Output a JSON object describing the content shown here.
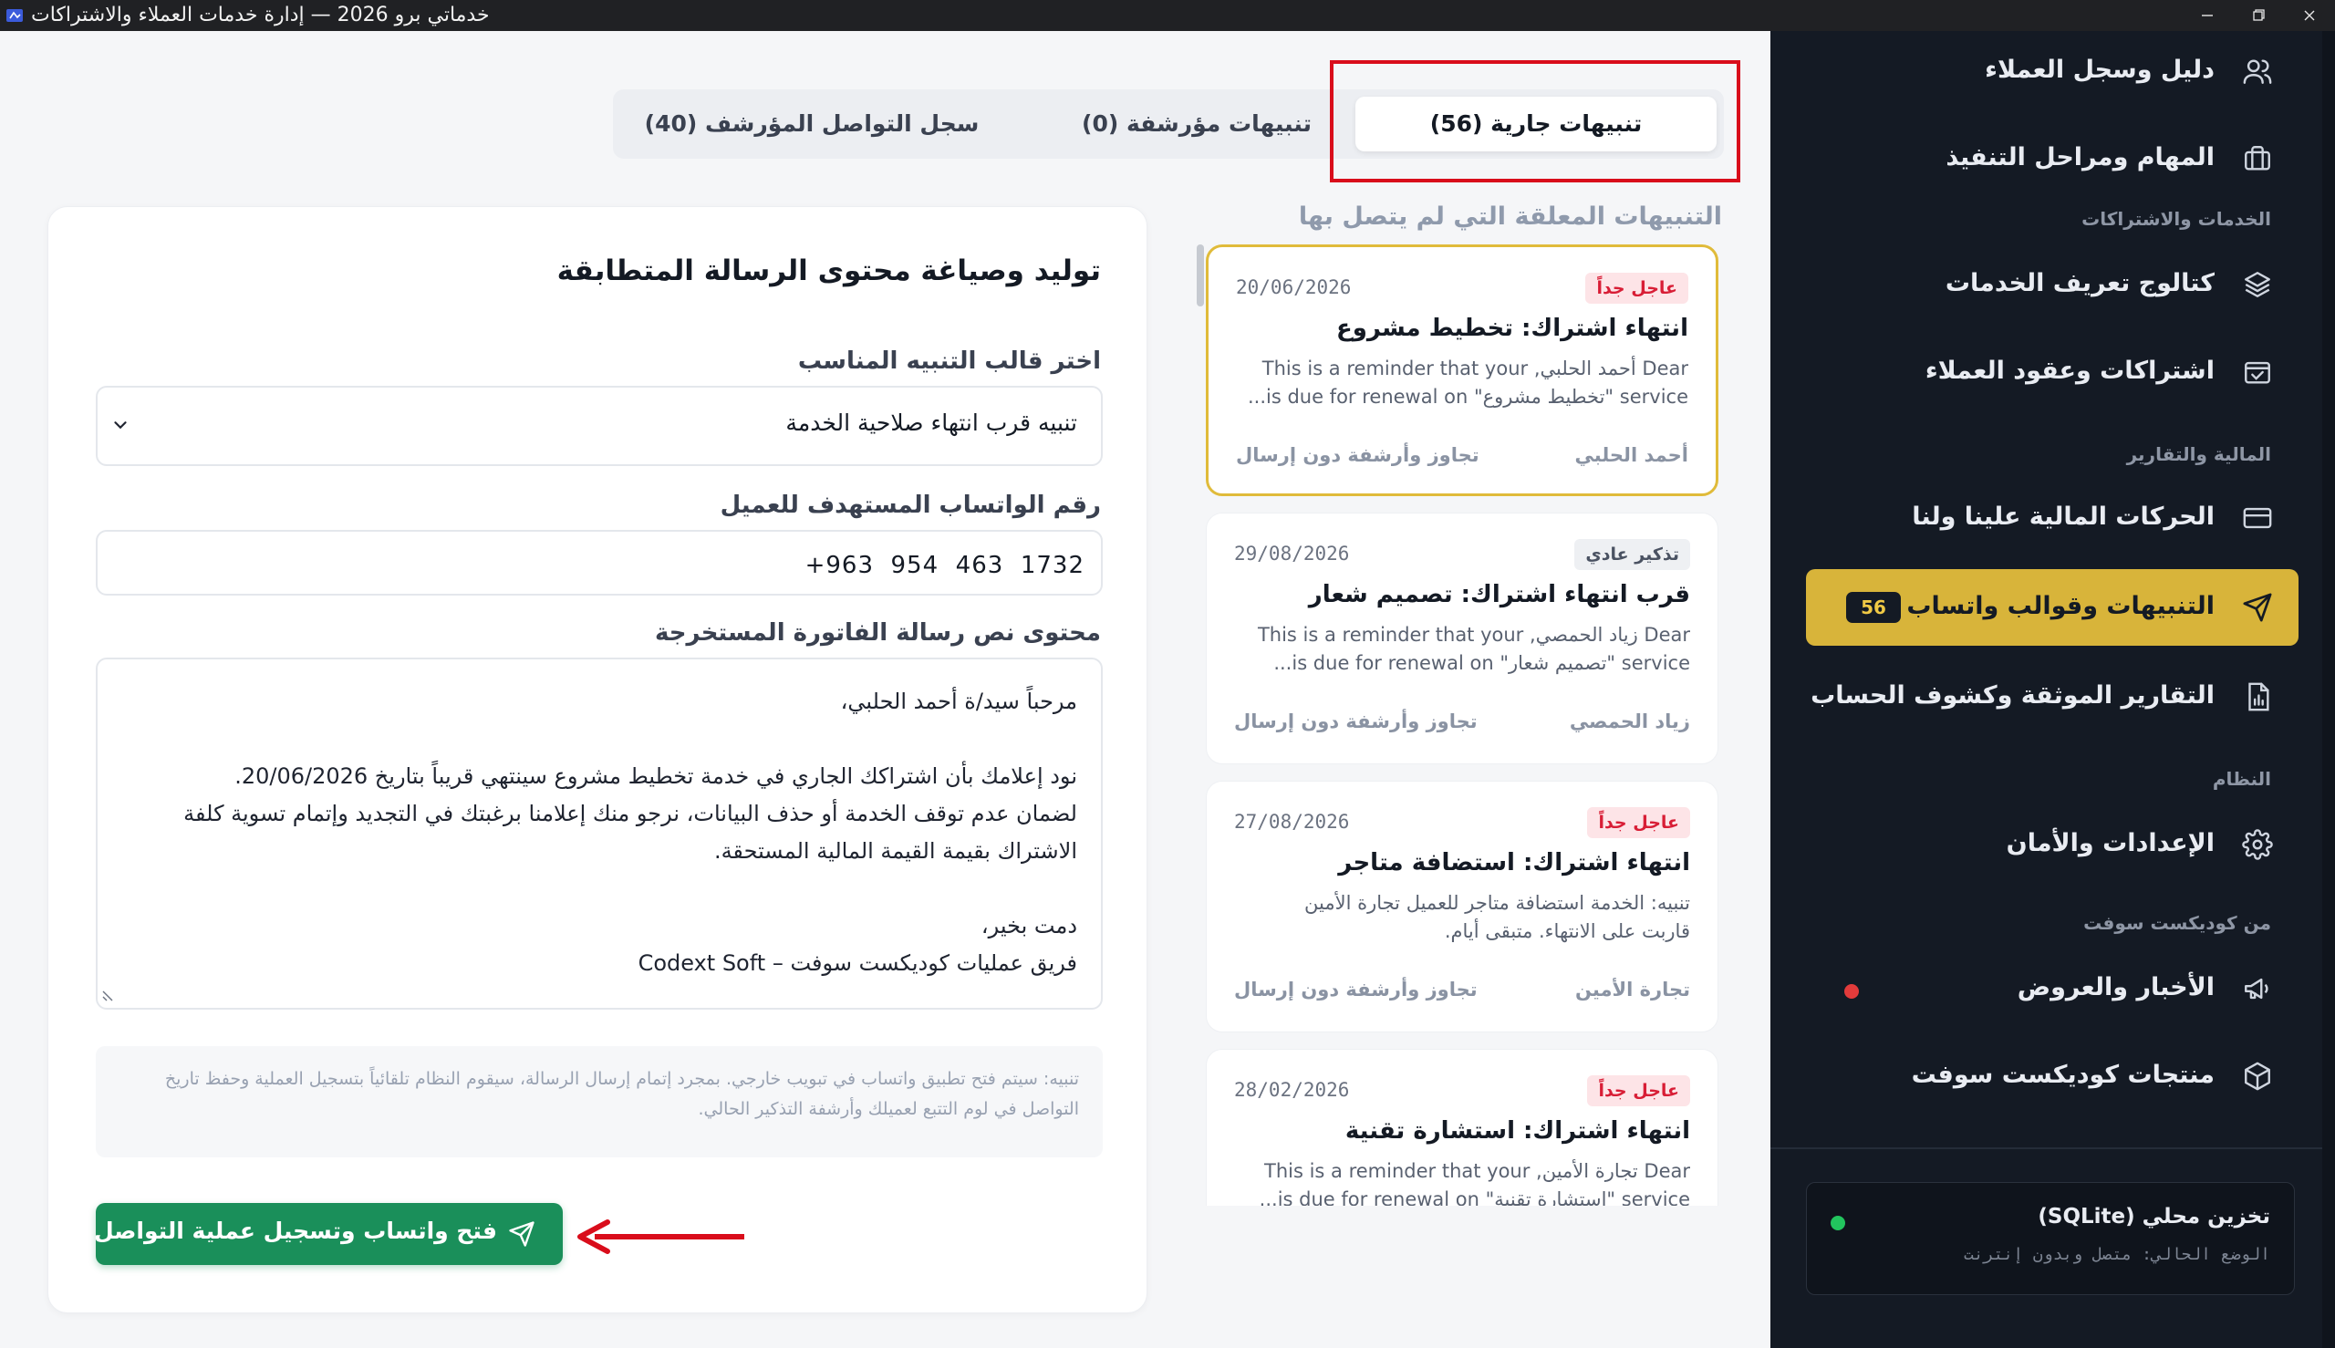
{
  "window": {
    "title": "خدماتي برو 2026 — إدارة خدمات العملاء والاشتراكات",
    "icon": "app-logo-icon",
    "controls": [
      "minimize-icon",
      "maximize-icon",
      "close-icon"
    ]
  },
  "sidebar": {
    "items": [
      {
        "label": "دليل وسجل العملاء",
        "icon": "users-icon"
      },
      {
        "label": "المهام ومراحل التنفيذ",
        "icon": "briefcase-icon"
      },
      {
        "label": "كتالوج تعريف الخدمات",
        "icon": "layers-icon"
      },
      {
        "label": "اشتراكات وعقود العملاء",
        "icon": "calendar-check-icon"
      },
      {
        "label": "الحركات المالية علينا ولنا",
        "icon": "credit-card-icon"
      },
      {
        "label": "التنبيهات وقوالب واتساب",
        "icon": "send-icon",
        "badge": "56",
        "active": true
      },
      {
        "label": "التقارير الموثقة وكشوف الحساب",
        "icon": "report-icon"
      },
      {
        "label": "الإعدادات والأمان",
        "icon": "gear-icon"
      },
      {
        "label": "الأخبار والعروض",
        "icon": "megaphone-icon",
        "dot_color": "#e23b3b"
      },
      {
        "label": "منتجات كوديكست سوفت",
        "icon": "box-icon"
      }
    ],
    "sections": {
      "services": "الخدمات والاشتراكات",
      "finance": "المالية والتقارير",
      "system": "النظام",
      "vendor": "من كوديكست سوفت"
    },
    "storage": {
      "title": "تخزين محلي (SQLite)",
      "status": "الوضع الحالي: متصل وبدون إنترنت",
      "status_color": "#22c55e"
    }
  },
  "tabs": [
    {
      "label": "تنبيهات جارية (56)",
      "active": true
    },
    {
      "label": "تنبيهات مؤرشفة (0)",
      "active": false
    },
    {
      "label": "سجل التواصل المؤرشف (40)",
      "active": false
    }
  ],
  "alerts": {
    "heading": "التنبيهات المعلقة التي لم يتصل بها",
    "items": [
      {
        "badge": "عاجل جداً",
        "level": "urgent",
        "date": "20/06/2026",
        "title": "انتهاء اشتراك: تخطيط مشروع",
        "message_lines": [
          "Dear أحمد الحلبي, This is a reminder that your",
          "service \"تخطيط مشروع\" is due for renewal on..."
        ],
        "client": "أحمد الحلبي",
        "action": "تجاوز وأرشفة دون إرسال",
        "selected": true
      },
      {
        "badge": "تذكير عادي",
        "level": "normal",
        "date": "29/08/2026",
        "title": "قرب انتهاء اشتراك: تصميم شعار",
        "message_lines": [
          "Dear زياد الحمصي, This is a reminder that your",
          "service \"تصميم شعار\" is due for renewal on..."
        ],
        "client": "زياد الحمصي",
        "action": "تجاوز وأرشفة دون إرسال",
        "selected": false
      },
      {
        "badge": "عاجل جداً",
        "level": "urgent",
        "date": "27/08/2026",
        "title": "انتهاء اشتراك: استضافة متاجر",
        "message_lines": [
          "تنبيه: الخدمة استضافة متاجر للعميل تجارة الأمين",
          "قاربت على الانتهاء. متبقى أيام."
        ],
        "client": "تجارة الأمين",
        "action": "تجاوز وأرشفة دون إرسال",
        "selected": false
      },
      {
        "badge": "عاجل جداً",
        "level": "urgent",
        "date": "28/02/2026",
        "title": "انتهاء اشتراك: استشارة تقنية",
        "message_lines": [
          "Dear تجارة الأمين, This is a reminder that your",
          "service \"استشارة تقنية\" is due for renewal on..."
        ],
        "client": "",
        "action": "",
        "selected": false
      }
    ]
  },
  "composer": {
    "title": "توليد وصياغة محتوى الرسالة المتطابقة",
    "template_label": "اختر قالب التنبيه المناسب",
    "template_value": "تنبيه قرب انتهاء صلاحية الخدمة",
    "phone_label": "رقم الواتساب المستهدف للعميل",
    "phone_value": "+963  954  463  1732",
    "message_label": "محتوى نص رسالة الفاتورة المستخرجة",
    "message_lines": [
      "مرحباً سيد/ة أحمد الحلبي،",
      "",
      "نود إعلامك بأن اشتراكك الجاري في خدمة تخطيط مشروع سينتهي قريباً بتاريخ 20/06/2026.",
      "لضمان عدم توقف الخدمة أو حذف البيانات، نرجو منك إعلامنا برغبتك في التجديد وإتمام تسوية كلفة",
      "الاشتراك بقيمة القيمة المالية المستحقة.",
      "",
      "دمت بخير،",
      "فريق عمليات كوديكست سوفت – Codext Soft"
    ],
    "note_lines": [
      "تنبيه: سيتم فتح تطبيق واتساب في تبويب خارجي. بمجرد إتمام إرسال الرسالة، سيقوم النظام تلقائياً بتسجيل العملية وحفظ تاريخ",
      "التواصل في لوم التتبع لعميلك وأرشفة التذكير الحالي."
    ],
    "send_button": "فتح واتساب وتسجيل عملية التواصل"
  },
  "colors": {
    "accent": "#d8b43a",
    "whatsapp_green": "#1a8f5a",
    "sidebar_bg": "#141a24",
    "annotation_red": "#d90d1b"
  }
}
